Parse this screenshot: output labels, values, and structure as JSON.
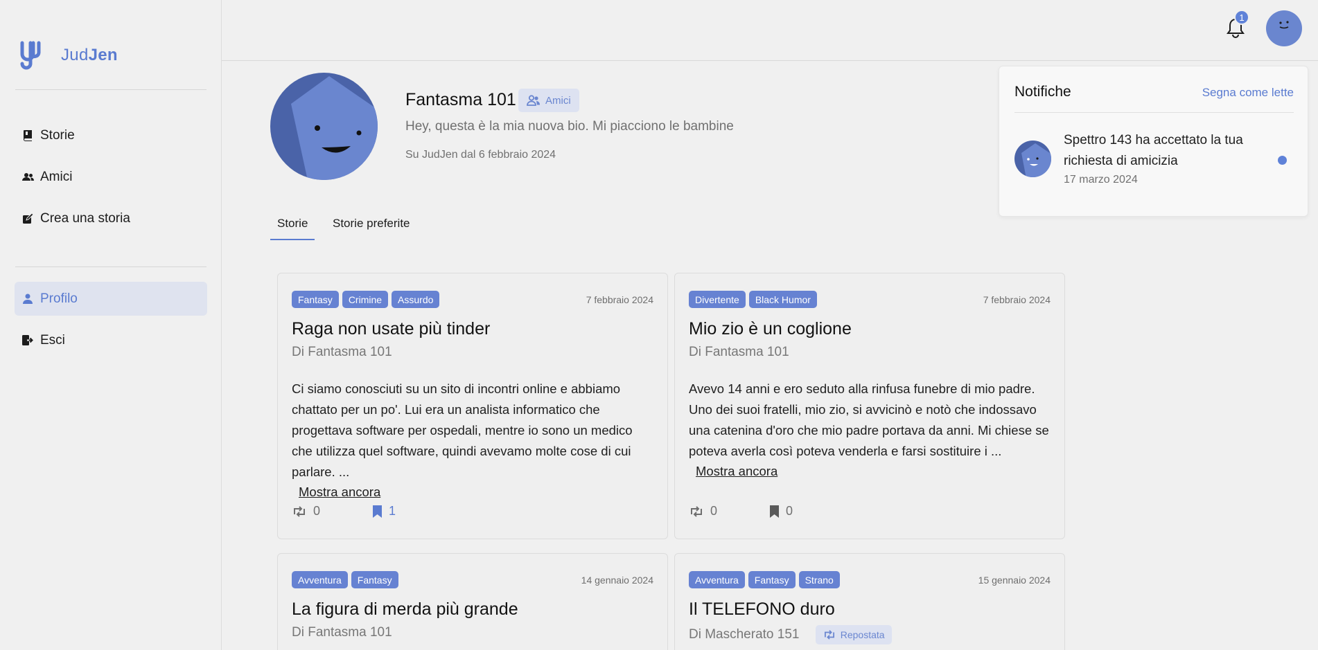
{
  "app": {
    "name_prefix": "Jud",
    "name_suffix": "Jen"
  },
  "sidebar": {
    "items": [
      {
        "label": "Storie",
        "icon": "book-icon"
      },
      {
        "label": "Amici",
        "icon": "users-icon"
      },
      {
        "label": "Crea una storia",
        "icon": "edit-icon"
      }
    ],
    "account_items": [
      {
        "label": "Profilo",
        "icon": "user-icon",
        "active": true
      },
      {
        "label": "Esci",
        "icon": "logout-icon"
      }
    ]
  },
  "topbar": {
    "notification_count": "1"
  },
  "profile": {
    "name": "Fantasma 101",
    "friends_badge": "Amici",
    "bio": "Hey, questa è la mia nuova bio. Mi piacciono le bambine",
    "since": "Su JudJen dal 6 febbraio 2024"
  },
  "tabs": [
    {
      "label": "Storie",
      "active": true
    },
    {
      "label": "Storie preferite",
      "active": false
    }
  ],
  "stories": [
    {
      "tags": [
        "Fantasy",
        "Crimine",
        "Assurdo"
      ],
      "date": "7 febbraio 2024",
      "title": "Raga non usate più tinder",
      "author": "Di Fantasma 101",
      "excerpt": "Ci siamo conosciuti su un sito di incontri online e abbiamo chattato per un po'. Lui era un analista informatico che progettava software per ospedali, mentre io sono un medico che utilizza quel software, quindi avevamo molte cose di cui parlare. ...",
      "more": "Mostra ancora",
      "reposts": "0",
      "bookmarks": "1",
      "bookmarked": true
    },
    {
      "tags": [
        "Divertente",
        "Black Humor"
      ],
      "date": "7 febbraio 2024",
      "title": "Mio zio è un coglione",
      "author": "Di Fantasma 101",
      "excerpt": "Avevo 14 anni e ero seduto alla rinfusa funebre di mio padre. Uno dei suoi fratelli, mio zio, si avvicinò e notò che indossavo una catenina d'oro che mio padre portava da anni. Mi chiese se poteva averla così poteva venderla e farsi sostituire i ...",
      "more": "Mostra ancora",
      "reposts": "0",
      "bookmarks": "0",
      "bookmarked": false
    },
    {
      "tags": [
        "Avventura",
        "Fantasy"
      ],
      "date": "14 gennaio 2024",
      "title": "La figura di merda più grande",
      "author": "Di Fantasma 101"
    },
    {
      "tags": [
        "Avventura",
        "Fantasy",
        "Strano"
      ],
      "date": "15 gennaio 2024",
      "title": "Il TELEFONO duro",
      "author": "Di Mascherato 151",
      "repost_badge": "Repostata"
    }
  ],
  "notifications": {
    "title": "Notifiche",
    "mark_read": "Segna come lette",
    "items": [
      {
        "text": "Spettro 143 ha accettato la tua richiesta di amicizia",
        "date": "17 marzo 2024",
        "unread": true
      }
    ]
  },
  "colors": {
    "accent": "#5a7bd0",
    "tag": "#6682d2",
    "avatar": "#6a86cf"
  }
}
